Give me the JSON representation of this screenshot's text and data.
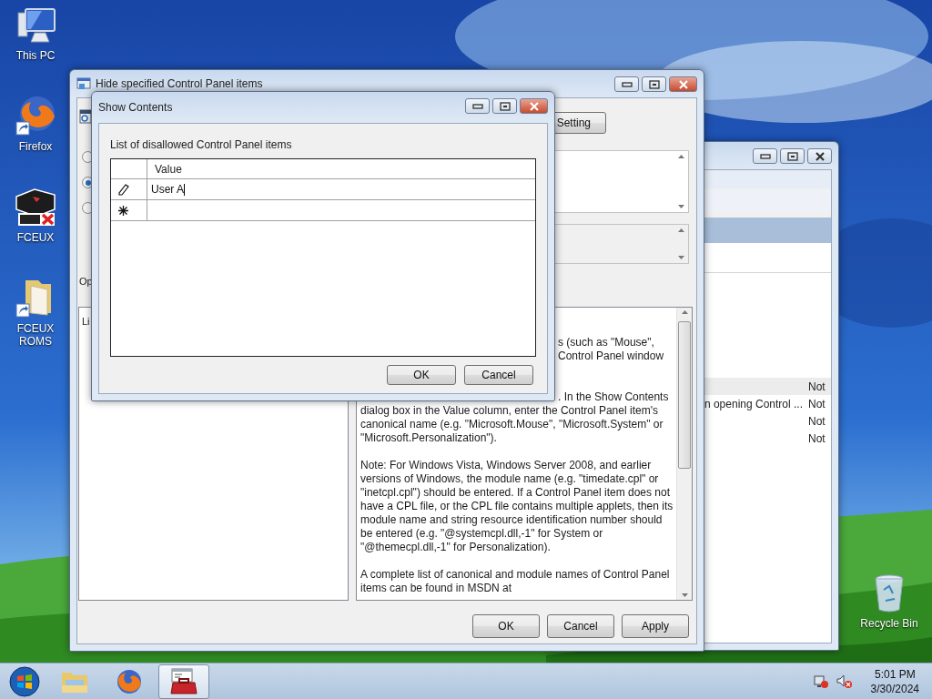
{
  "desktop_icons": [
    {
      "label": "This PC",
      "kind": "computer"
    },
    {
      "label": "Firefox",
      "kind": "browser"
    },
    {
      "label": "FCEUX",
      "kind": "emulator"
    },
    {
      "label": "FCEUX ROMS",
      "kind": "folder"
    }
  ],
  "recycle_bin": {
    "label": "Recycle Bin"
  },
  "back_window": {
    "rows": [
      {
        "column_2": "Not",
        "selected": true
      },
      {
        "column_1": "n opening Control ...",
        "column_2": "Not",
        "selected": false
      },
      {
        "column_2": "Not",
        "selected": false
      },
      {
        "column_2": "Not",
        "selected": false
      }
    ]
  },
  "policy_window": {
    "title": "Hide specified Control Panel items",
    "setting_button": "Setting",
    "radios": [
      {
        "selected": false
      },
      {
        "selected": true
      },
      {
        "selected": false
      }
    ],
    "options_label": "Op",
    "options_text": "Li",
    "help_paragraphs": [
      {
        "lines": [
          {
            "text": "s (such as \"Mouse\",",
            "kind": "partial"
          },
          {
            "text": "Control Panel window",
            "kind": "partial"
          }
        ]
      },
      {
        "lines": [
          {
            "text": ". In the Show Contents",
            "kind": "partial"
          },
          {
            "text": "dialog box in the Value column, enter the Control Panel item's",
            "kind": "full"
          },
          {
            "text": "canonical name (e.g. \"Microsoft.Mouse\", \"Microsoft.System\" or",
            "kind": "full"
          },
          {
            "text": "\"Microsoft.Personalization\").",
            "kind": "full"
          }
        ]
      },
      {
        "lines": [
          {
            "text": "Note: For Windows Vista, Windows Server 2008, and earlier",
            "kind": "full"
          },
          {
            "text": "versions of Windows, the module name (e.g. \"timedate.cpl\" or",
            "kind": "full"
          },
          {
            "text": "\"inetcpl.cpl\") should be entered. If a Control Panel item does not",
            "kind": "full"
          },
          {
            "text": "have a CPL file, or the CPL file contains multiple applets, then its",
            "kind": "full"
          },
          {
            "text": "module name and string resource identification number should",
            "kind": "full"
          },
          {
            "text": "be entered (e.g. \"@systemcpl.dll,-1\" for System or",
            "kind": "full"
          },
          {
            "text": "\"@themecpl.dll,-1\" for Personalization).",
            "kind": "full"
          }
        ]
      },
      {
        "lines": [
          {
            "text": "A complete list of canonical and module names of Control Panel",
            "kind": "full"
          },
          {
            "text": "items can be found in MSDN at",
            "kind": "full"
          }
        ]
      }
    ],
    "buttons": [
      "OK",
      "Cancel",
      "Apply"
    ]
  },
  "dialog": {
    "title": "Show Contents",
    "label": "List of disallowed Control Panel items",
    "column": "Value",
    "rows": [
      {
        "kind": "editing",
        "value": "User A"
      },
      {
        "kind": "new"
      }
    ],
    "buttons": [
      "OK",
      "Cancel"
    ]
  },
  "taskbar": {
    "apps": [
      {
        "kind": "explorer",
        "active": false
      },
      {
        "kind": "browser",
        "active": false
      },
      {
        "kind": "toolbox",
        "active": true
      }
    ],
    "time": "5:01 PM",
    "date": "3/30/2024"
  }
}
